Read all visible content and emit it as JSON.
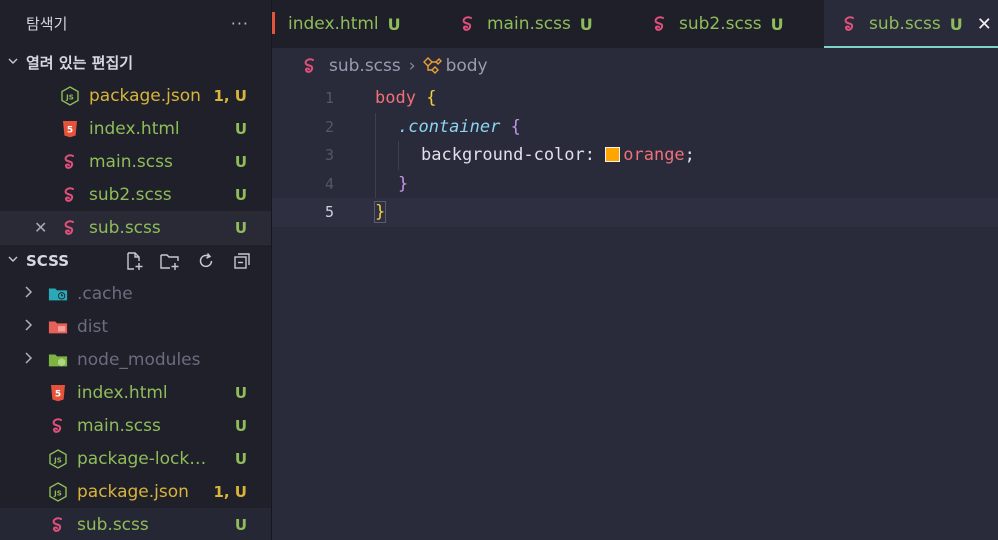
{
  "sidebar": {
    "title": "탐색기",
    "more": "···",
    "open_editors": {
      "label": "열려 있는 편집기",
      "items": [
        {
          "name": "package.json",
          "badge": "1, U",
          "icon": "nodejs-icon"
        },
        {
          "name": "index.html",
          "badge": "U",
          "icon": "html-icon"
        },
        {
          "name": "main.scss",
          "badge": "U",
          "icon": "sass-icon"
        },
        {
          "name": "sub2.scss",
          "badge": "U",
          "icon": "sass-icon"
        },
        {
          "name": "sub.scss",
          "badge": "U",
          "icon": "sass-icon",
          "close": "✕"
        }
      ]
    },
    "folder": {
      "label": "SCSS",
      "items": [
        {
          "name": ".cache",
          "badge": "",
          "icon": "folder-cache-icon"
        },
        {
          "name": "dist",
          "badge": "",
          "icon": "folder-dist-icon"
        },
        {
          "name": "node_modules",
          "badge": "",
          "icon": "folder-node-icon"
        },
        {
          "name": "index.html",
          "badge": "U",
          "icon": "html-icon"
        },
        {
          "name": "main.scss",
          "badge": "U",
          "icon": "sass-icon"
        },
        {
          "name": "package-lock.js...",
          "badge": "U",
          "icon": "nodejs-icon"
        },
        {
          "name": "package.json",
          "badge": "1, U",
          "icon": "nodejs-icon"
        },
        {
          "name": "sub.scss",
          "badge": "U",
          "icon": "sass-icon"
        }
      ]
    }
  },
  "tabs": [
    {
      "label": "index.html",
      "badge": "U"
    },
    {
      "label": "main.scss",
      "badge": "U"
    },
    {
      "label": "sub2.scss",
      "badge": "U"
    },
    {
      "label": "sub.scss",
      "badge": "U",
      "close": "✕"
    }
  ],
  "breadcrumb": {
    "file": "sub.scss",
    "sep": "›",
    "symbol": "body"
  },
  "code": {
    "line_numbers": [
      "1",
      "2",
      "3",
      "4",
      "5"
    ],
    "l1_sel": "body",
    "l1_brace": "{",
    "l2_class": ".container",
    "l2_brace": "{",
    "l3_prop": "background-color:",
    "l3_val": "orange",
    "l3_semi": ";",
    "l4_brace": "}",
    "l5_brace": "}"
  },
  "colors": {
    "swatch": "#ffa500",
    "accent": "#7dd3c8"
  }
}
